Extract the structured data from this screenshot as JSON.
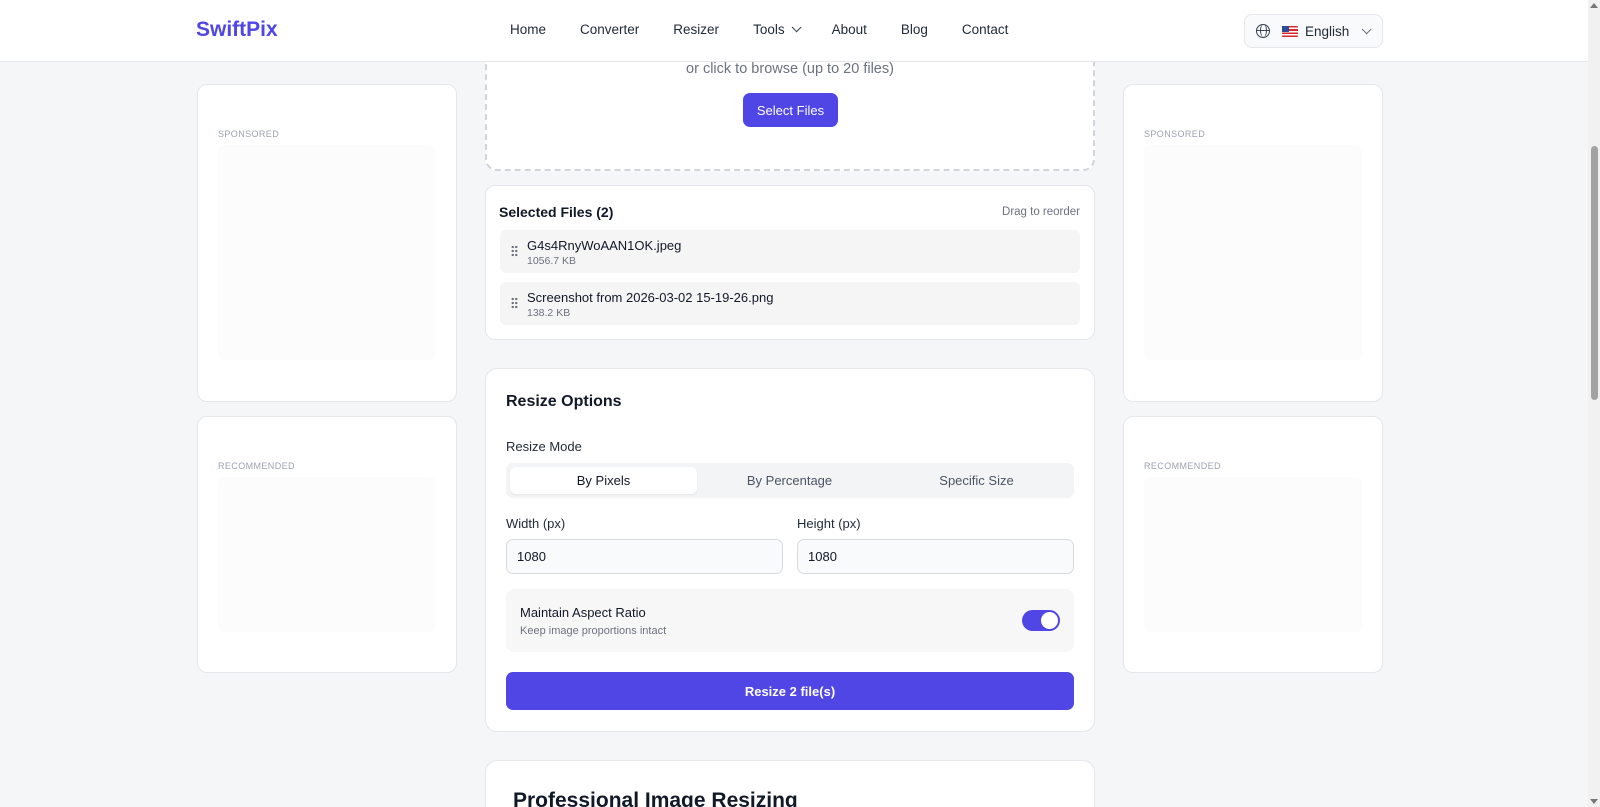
{
  "header": {
    "logo": "SwiftPix",
    "nav": [
      "Home",
      "Converter",
      "Resizer",
      "Tools",
      "About",
      "Blog",
      "Contact"
    ],
    "language": "English",
    "flag": "us-flag-icon"
  },
  "upload": {
    "hint": "or click to browse (up to 20 files)",
    "button": "Select Files"
  },
  "ads": {
    "sponsored": "SPONSORED",
    "recommended": "RECOMMENDED"
  },
  "files": {
    "title": "Selected Files (2)",
    "reorder_hint": "Drag to reorder",
    "items": [
      {
        "name": "G4s4RnyWoAAN1OK.jpeg",
        "size": "1056.7 KB"
      },
      {
        "name": "Screenshot from 2026-03-02 15-19-26.png",
        "size": "138.2 KB"
      }
    ]
  },
  "options": {
    "title": "Resize Options",
    "mode_label": "Resize Mode",
    "modes": [
      "By Pixels",
      "By Percentage",
      "Specific Size"
    ],
    "active_mode": "By Pixels",
    "width_label": "Width (px)",
    "width_value": "1080",
    "height_label": "Height (px)",
    "height_value": "1080",
    "aspect_title": "Maintain Aspect Ratio",
    "aspect_sub": "Keep image proportions intact",
    "aspect_on": true,
    "resize_button": "Resize 2 file(s)"
  },
  "section": {
    "title": "Professional Image Resizing"
  },
  "colors": {
    "accent": "#4f46e5",
    "background": "#f5f6f8"
  }
}
